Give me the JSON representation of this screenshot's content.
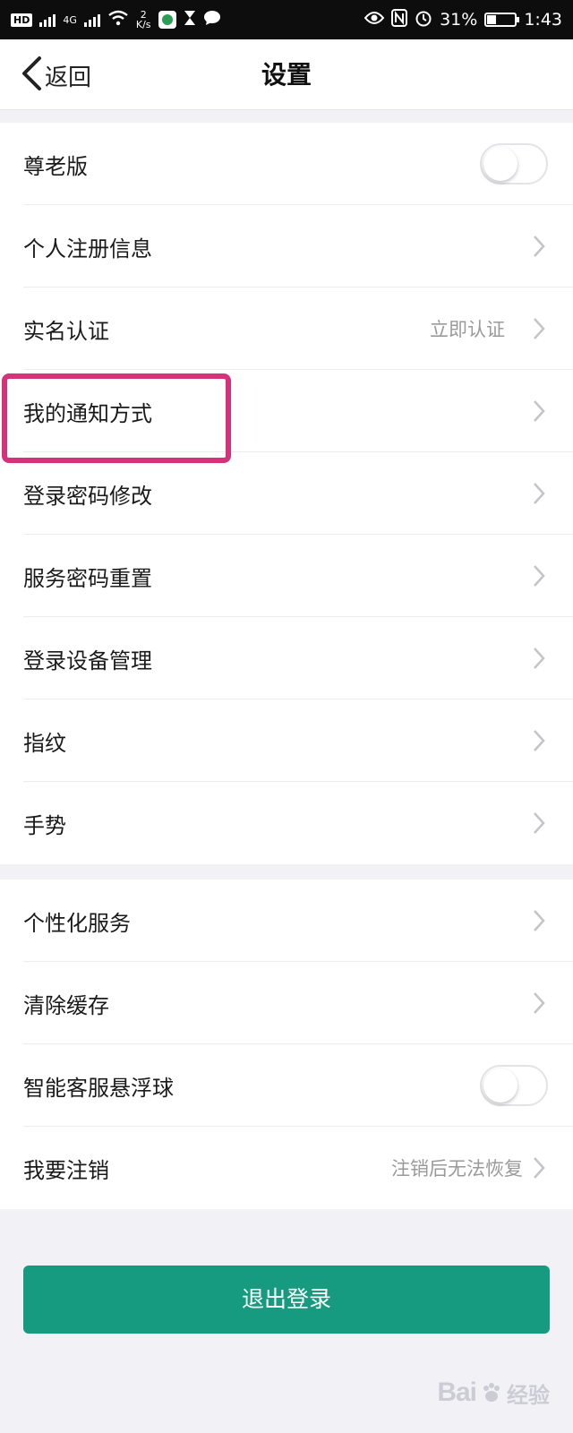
{
  "status_bar": {
    "hd_badge": "HD",
    "net_speed_value": "2",
    "net_speed_unit": "K/s",
    "signal_label": "4G",
    "battery_percent": "31%",
    "time": "1:43"
  },
  "header": {
    "back_label": "返回",
    "title": "设置"
  },
  "group1": [
    {
      "label": "尊老版",
      "control": "toggle",
      "on": false
    },
    {
      "label": "个人注册信息",
      "control": "chevron"
    },
    {
      "label": "实名认证",
      "value": "立即认证",
      "control": "chevron"
    },
    {
      "label": "我的通知方式",
      "control": "chevron",
      "highlighted": true
    },
    {
      "label": "登录密码修改",
      "control": "chevron"
    },
    {
      "label": "服务密码重置",
      "control": "chevron"
    },
    {
      "label": "登录设备管理",
      "control": "chevron"
    },
    {
      "label": "指纹",
      "control": "chevron"
    },
    {
      "label": "手势",
      "control": "chevron"
    }
  ],
  "group2": [
    {
      "label": "个性化服务",
      "control": "chevron"
    },
    {
      "label": "清除缓存",
      "control": "chevron"
    },
    {
      "label": "智能客服悬浮球",
      "control": "toggle",
      "on": false
    },
    {
      "label": "我要注销",
      "value": "注销后无法恢复",
      "control": "chevron"
    }
  ],
  "logout_label": "退出登录",
  "watermark": {
    "brand_left": "Bai",
    "brand_right": "经验"
  },
  "colors": {
    "accent": "#169b80",
    "highlight": "#d6317b",
    "background": "#f2f2f6"
  }
}
